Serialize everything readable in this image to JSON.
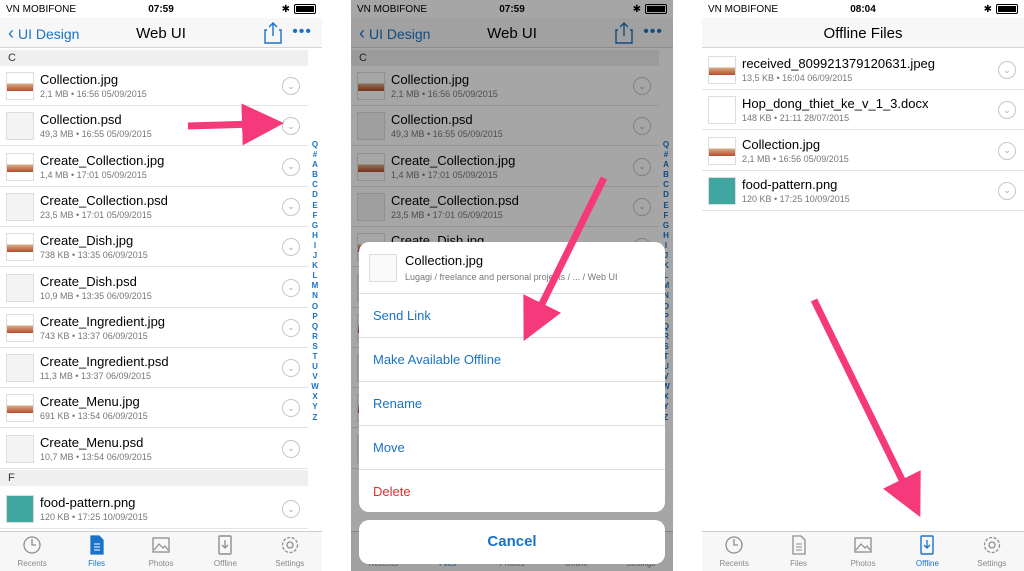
{
  "colors": {
    "accent": "#1a73c8",
    "danger": "#e0302f",
    "arrow": "#f6397a"
  },
  "screens": [
    {
      "status": {
        "carrier": "VN MOBIFONE",
        "time": "07:59"
      },
      "nav": {
        "back_label": "UI Design",
        "title": "Web UI"
      },
      "sections": [
        "C",
        "F"
      ],
      "files": [
        {
          "name": "Collection.jpg",
          "meta": "2,1 MB • 16:56 05/09/2015"
        },
        {
          "name": "Collection.psd",
          "meta": "49,3 MB • 16:55 05/09/2015"
        },
        {
          "name": "Create_Collection.jpg",
          "meta": "1,4 MB • 17:01 05/09/2015"
        },
        {
          "name": "Create_Collection.psd",
          "meta": "23,5 MB • 17:01 05/09/2015"
        },
        {
          "name": "Create_Dish.jpg",
          "meta": "738 KB • 13:35 06/09/2015"
        },
        {
          "name": "Create_Dish.psd",
          "meta": "10,9 MB • 13:35 06/09/2015"
        },
        {
          "name": "Create_Ingredient.jpg",
          "meta": "743 KB • 13:37 06/09/2015"
        },
        {
          "name": "Create_Ingredient.psd",
          "meta": "11,3 MB • 13:37 06/09/2015"
        },
        {
          "name": "Create_Menu.jpg",
          "meta": "691 KB • 13:54 06/09/2015"
        },
        {
          "name": "Create_Menu.psd",
          "meta": "10,7 MB • 13:54 06/09/2015"
        },
        {
          "name": "food-pattern.png",
          "meta": "120 KB • 17:25 10/09/2015"
        }
      ],
      "index_letters": "Q#ABCDEFGHIJKLMNOPQRSTUVWXYZ"
    },
    {
      "status": {
        "carrier": "VN MOBIFONE",
        "time": "07:59"
      },
      "nav": {
        "back_label": "UI Design",
        "title": "Web UI"
      },
      "sheet": {
        "file_name": "Collection.jpg",
        "path": "Lugagi / freelance and personal projects / ... / Web UI",
        "actions": [
          "Send Link",
          "Make Available Offline",
          "Rename",
          "Move",
          "Delete"
        ],
        "cancel": "Cancel"
      }
    },
    {
      "status": {
        "carrier": "VN MOBIFONE",
        "time": "08:04"
      },
      "nav": {
        "title": "Offline Files"
      },
      "files": [
        {
          "name": "received_809921379120631.jpeg",
          "meta": "13,5 KB • 16:04 06/09/2015"
        },
        {
          "name": "Hop_dong_thiet_ke_v_1_3.docx",
          "meta": "148 KB • 21:11 28/07/2015"
        },
        {
          "name": "Collection.jpg",
          "meta": "2,1 MB • 16:56 05/09/2015"
        },
        {
          "name": "food-pattern.png",
          "meta": "120 KB • 17:25 10/09/2015"
        }
      ]
    }
  ],
  "tabs": [
    {
      "label": "Recents",
      "icon": "clock-icon"
    },
    {
      "label": "Files",
      "icon": "file-icon"
    },
    {
      "label": "Photos",
      "icon": "photo-icon"
    },
    {
      "label": "Offline",
      "icon": "offline-icon"
    },
    {
      "label": "Settings",
      "icon": "gear-icon"
    }
  ]
}
